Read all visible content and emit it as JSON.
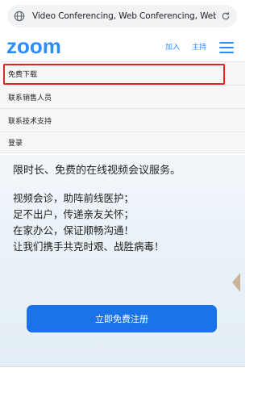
{
  "browser": {
    "url": "Video Conferencing, Web Conferencing, Webi..."
  },
  "header": {
    "logo_text": "zoom",
    "nav_join": "加入",
    "nav_host": "主持"
  },
  "menu": {
    "items": [
      {
        "label": "免费下载"
      },
      {
        "label": "联系销售人员"
      },
      {
        "label": "联系技术支持"
      },
      {
        "label": "登录"
      }
    ]
  },
  "hero": {
    "headline": "限时长、免费的在线视频会议服务。",
    "lines": [
      "视频会诊，助阵前线医护；",
      "足不出户，传递亲友关怀；",
      "在家办公，保证顺畅沟通！",
      "让我们携手共克时艰、战胜病毒！"
    ],
    "cta_label": "立即免费注册"
  },
  "colors": {
    "brand_blue": "#2d8cff",
    "cta_blue": "#1a73e8",
    "highlight_red": "#e02424"
  },
  "icons": {
    "url_icon": "globe-icon",
    "reload": "reload-icon",
    "menu": "hamburger-menu-icon"
  }
}
